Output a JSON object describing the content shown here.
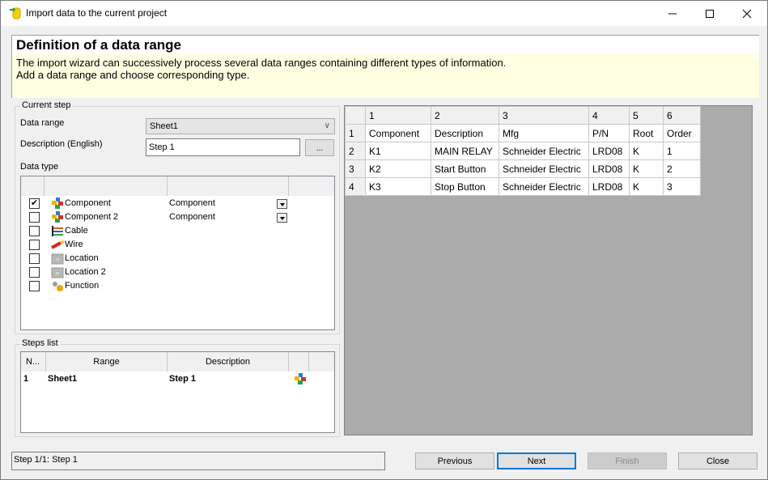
{
  "window": {
    "title": "Import data to the current project",
    "controls": [
      "minimize",
      "maximize",
      "close"
    ]
  },
  "header": {
    "title": "Definition of a data range",
    "description_line1": "The import wizard can successively process several data ranges containing different types of information.",
    "description_line2": "Add a data range and choose corresponding type."
  },
  "current_step": {
    "group_label": "Current step",
    "data_range_label": "Data range",
    "data_range_value": "Sheet1",
    "description_label": "Description (English)",
    "description_value": "Step 1",
    "browse_label": "...",
    "data_type_label": "Data type",
    "data_types": [
      {
        "name": "Component",
        "checked": true,
        "type": "Component",
        "icon": "component-icon"
      },
      {
        "name": "Component 2",
        "checked": false,
        "type": "Component",
        "icon": "component-icon"
      },
      {
        "name": "Cable",
        "checked": false,
        "type": "",
        "icon": "cable-icon"
      },
      {
        "name": "Wire",
        "checked": false,
        "type": "",
        "icon": "wire-icon"
      },
      {
        "name": "Location",
        "checked": false,
        "type": "",
        "icon": "location-icon"
      },
      {
        "name": "Location 2",
        "checked": false,
        "type": "",
        "icon": "location-icon"
      },
      {
        "name": "Function",
        "checked": false,
        "type": "",
        "icon": "function-icon"
      }
    ]
  },
  "steps_list": {
    "group_label": "Steps list",
    "columns": [
      "N...",
      "Range",
      "Description",
      ""
    ],
    "rows": [
      {
        "n": "1",
        "range": "Sheet1",
        "description": "Step 1",
        "icon": "component-icon"
      }
    ]
  },
  "sheet": {
    "column_headers": [
      "1",
      "2",
      "3",
      "4",
      "5",
      "6"
    ],
    "rows": [
      {
        "row": "1",
        "cells": [
          "Component",
          "Description",
          "Mfg",
          "P/N",
          "Root",
          "Order"
        ]
      },
      {
        "row": "2",
        "cells": [
          "K1",
          "MAIN RELAY",
          "Schneider Electric",
          "LRD08",
          "K",
          "1"
        ]
      },
      {
        "row": "3",
        "cells": [
          "K2",
          "Start Button",
          "Schneider Electric",
          "LRD08",
          "K",
          "2"
        ]
      },
      {
        "row": "4",
        "cells": [
          "K3",
          "Stop Button",
          "Schneider Electric",
          "LRD08",
          "K",
          "3"
        ]
      }
    ]
  },
  "footer": {
    "status": "Step 1/1: Step 1",
    "previous_label": "Previous",
    "next_label": "Next",
    "finish_label": "Finish",
    "close_label": "Close"
  },
  "colors": {
    "header_bg": "#ffffe1",
    "accent": "#0078d7",
    "grid_bg": "#ababab"
  }
}
